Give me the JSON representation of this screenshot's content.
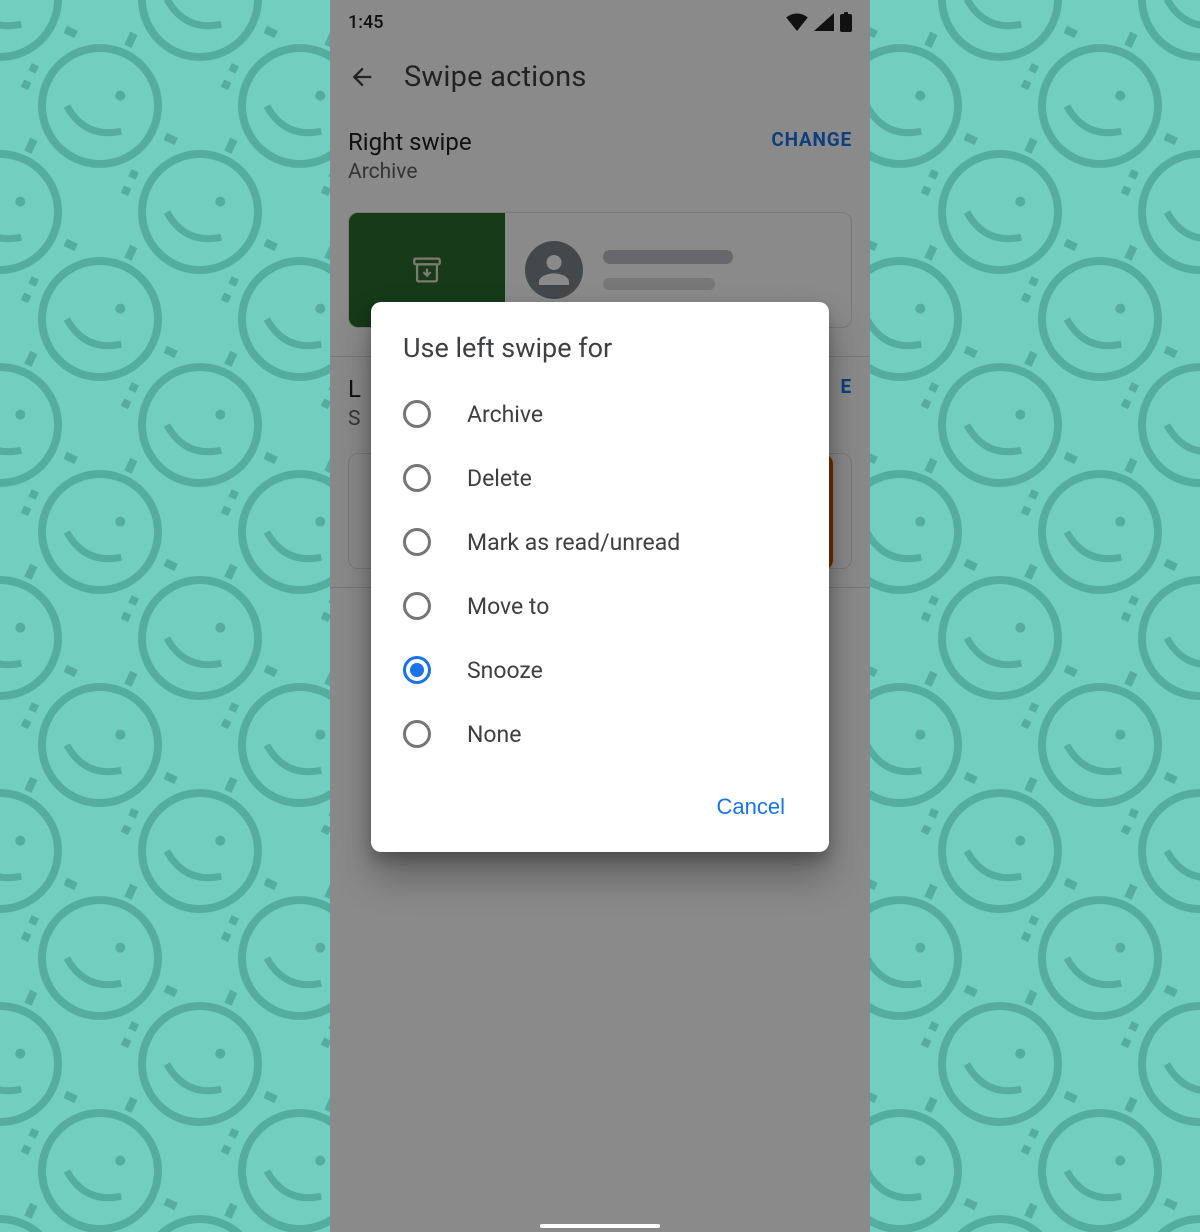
{
  "status": {
    "time": "1:45"
  },
  "header": {
    "title": "Swipe actions"
  },
  "right_swipe": {
    "title": "Right swipe",
    "value": "Archive",
    "change_label": "CHANGE",
    "swipe_color": "#2b6b2d",
    "swipe_icon": "archive-icon"
  },
  "left_swipe": {
    "title_first_char": "L",
    "value_first_char": "S",
    "change_suffix": "E",
    "swipe_color": "#d35400"
  },
  "dialog": {
    "title": "Use left swipe for",
    "options": [
      {
        "label": "Archive",
        "selected": false
      },
      {
        "label": "Delete",
        "selected": false
      },
      {
        "label": "Mark as read/unread",
        "selected": false
      },
      {
        "label": "Move to",
        "selected": false
      },
      {
        "label": "Snooze",
        "selected": true
      },
      {
        "label": "None",
        "selected": false
      }
    ],
    "cancel_label": "Cancel"
  },
  "colors": {
    "accent": "#1a73e8",
    "background": "#72cfc0"
  }
}
